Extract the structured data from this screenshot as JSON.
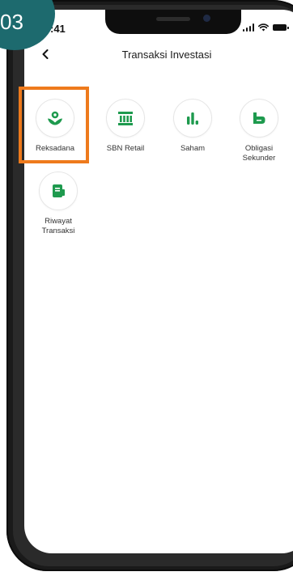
{
  "step_badge": "03",
  "status_bar": {
    "time": ":41"
  },
  "header": {
    "title": "Transaksi Investasi",
    "back_icon": "chevron-left-icon"
  },
  "menu": [
    {
      "label": "Reksadana",
      "icon": "reksadana-icon",
      "highlighted": true
    },
    {
      "label": "SBN Retail",
      "icon": "bank-building-icon",
      "highlighted": false
    },
    {
      "label": "Saham",
      "icon": "bar-chart-icon",
      "highlighted": false
    },
    {
      "label": "Obligasi\nSekunder",
      "icon": "bond-icon",
      "highlighted": false
    },
    {
      "label": "Riwayat\nTransaksi",
      "icon": "wallet-icon",
      "highlighted": false
    }
  ],
  "colors": {
    "accent_green": "#1e9a4e",
    "highlight_orange": "#ee7a1c",
    "badge_teal": "#1d6a6e"
  }
}
